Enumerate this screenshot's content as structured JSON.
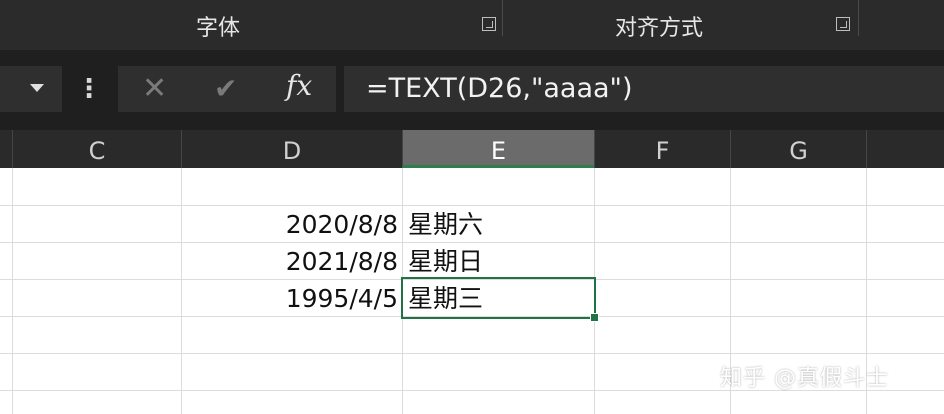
{
  "ribbon": {
    "groups": [
      {
        "label": "字体"
      },
      {
        "label": "对齐方式"
      }
    ]
  },
  "formula_bar": {
    "fx_label": "fx",
    "formula": "=TEXT(D26,\"aaaa\")"
  },
  "columns": [
    "C",
    "D",
    "E",
    "F",
    "G"
  ],
  "selected_column": "E",
  "rows": [
    {
      "date": "2020/8/8",
      "weekday": "星期六"
    },
    {
      "date": "2021/8/8",
      "weekday": "星期日"
    },
    {
      "date": "1995/4/5",
      "weekday": "星期三"
    }
  ],
  "watermark": "知乎 @真假斗士",
  "colors": {
    "accent": "#217346"
  }
}
